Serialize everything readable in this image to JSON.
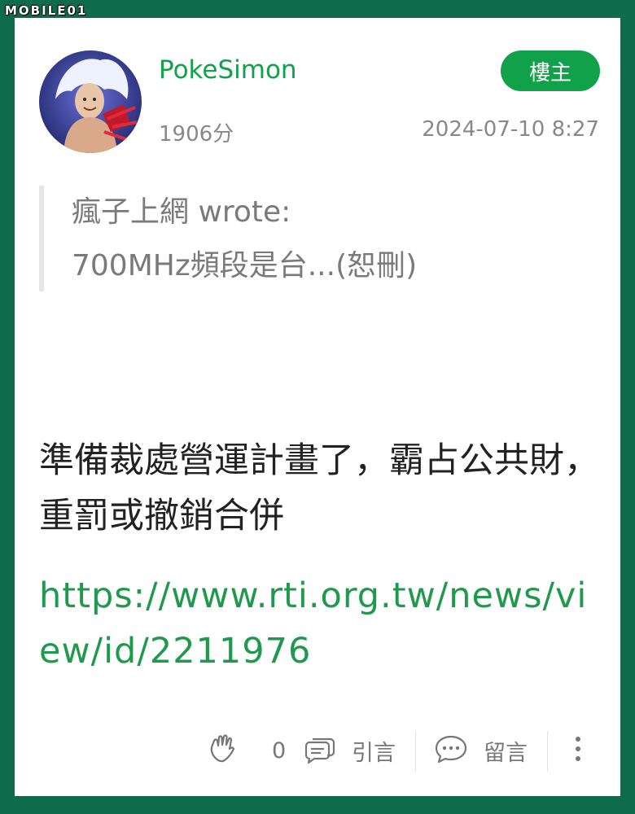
{
  "watermark": {
    "text": "MOBILE01"
  },
  "post": {
    "username": "PokeSimon",
    "badge": "樓主",
    "score": "1906分",
    "timestamp": "2024-07-10 8:27",
    "quote": {
      "line1": "瘋子上網 wrote:",
      "line2": "700MHz頻段是台...(恕刪)"
    },
    "body": "準備裁處營運計畫了，霸占公共財，重罰或撤銷合併",
    "link": "https://www.rti.org.tw/news/view/id/2211976"
  },
  "footer": {
    "like_count": "0",
    "quote_label": "引言",
    "comment_label": "留言",
    "icons": [
      "clap-icon",
      "quote-chat-icon",
      "comment-bubble-icon",
      "more-vertical-icon"
    ]
  },
  "colors": {
    "frame": "#0e6b4c",
    "accent": "#12a14b",
    "link": "#1f9a4c"
  }
}
